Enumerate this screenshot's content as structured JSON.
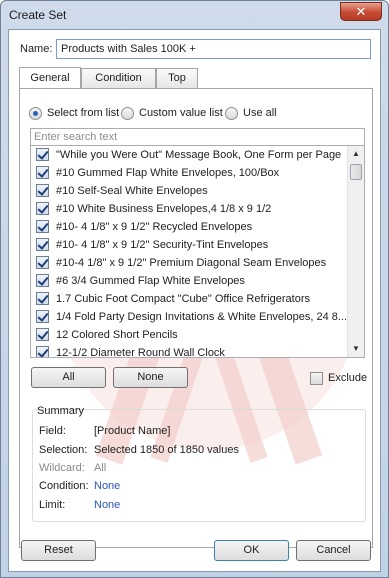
{
  "window": {
    "title": "Create Set",
    "close_glyph": "✕"
  },
  "name_field": {
    "label": "Name:",
    "value": "Products with Sales 100K +"
  },
  "tabs": [
    {
      "label": "General",
      "active": true
    },
    {
      "label": "Condition",
      "active": false
    },
    {
      "label": "Top",
      "active": false
    }
  ],
  "mode": {
    "options": [
      {
        "label": "Select from list",
        "selected": true
      },
      {
        "label": "Custom value list",
        "selected": false
      },
      {
        "label": "Use all",
        "selected": false
      }
    ]
  },
  "search": {
    "placeholder": "Enter search text",
    "value": ""
  },
  "list": {
    "items": [
      {
        "label": "\"While you Were Out\" Message Book, One Form per Page",
        "checked": true
      },
      {
        "label": "#10 Gummed Flap White Envelopes, 100/Box",
        "checked": true
      },
      {
        "label": "#10 Self-Seal White Envelopes",
        "checked": true
      },
      {
        "label": "#10 White Business Envelopes,4 1/8 x 9 1/2",
        "checked": true
      },
      {
        "label": "#10- 4 1/8\" x 9 1/2\" Recycled Envelopes",
        "checked": true
      },
      {
        "label": "#10- 4 1/8\" x 9 1/2\" Security-Tint Envelopes",
        "checked": true
      },
      {
        "label": "#10-4 1/8\" x 9 1/2\" Premium Diagonal Seam Envelopes",
        "checked": true
      },
      {
        "label": "#6 3/4 Gummed Flap White Envelopes",
        "checked": true
      },
      {
        "label": "1.7 Cubic Foot Compact \"Cube\" Office Refrigerators",
        "checked": true
      },
      {
        "label": "1/4 Fold Party Design Invitations & White Envelopes, 24 8...",
        "checked": true
      },
      {
        "label": "12 Colored Short Pencils",
        "checked": true
      },
      {
        "label": "12-1/2 Diameter Round Wall Clock",
        "checked": true
      }
    ],
    "scroll_up_glyph": "▲",
    "scroll_down_glyph": "▼"
  },
  "buttons": {
    "all": "All",
    "none": "None",
    "exclude_label": "Exclude",
    "reset": "Reset",
    "ok": "OK",
    "cancel": "Cancel"
  },
  "summary": {
    "title": "Summary",
    "field_label": "Field:",
    "field_value": "[Product Name]",
    "selection_label": "Selection:",
    "selection_value": "Selected 1850 of 1850 values",
    "wildcard_label": "Wildcard:",
    "wildcard_value": "All",
    "condition_label": "Condition:",
    "condition_value": "None",
    "limit_label": "Limit:",
    "limit_value": "None"
  },
  "colors": {
    "link": "#2a54b8",
    "accent": "#2c63b5",
    "watermark": "#f4d6d3"
  }
}
